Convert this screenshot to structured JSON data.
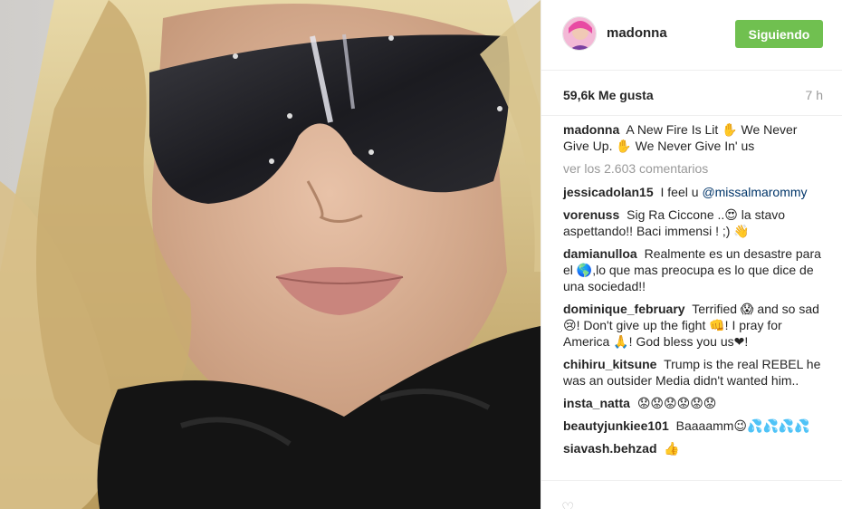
{
  "post": {
    "photo_alt": "",
    "header": {
      "username": "madonna",
      "follow_label": "Siguiendo"
    },
    "stats": {
      "likes": "59,6k Me gusta",
      "time": "7 h"
    },
    "caption": {
      "user": "madonna",
      "text": "A New Fire Is Lit ✋ We Never Give Up. ✋ We Never Give In' us"
    },
    "view_comments_label": "ver los 2.603 comentarios",
    "comments": [
      {
        "user": "jessicadolan15",
        "text": "I feel u",
        "mention": "@missalmarommy"
      },
      {
        "user": "vorenuss",
        "text": "Sig Ra Ciccone ..😍 la stavo aspettando!! Baci immensi ! ;) 👋",
        "mention": ""
      },
      {
        "user": "damianulloa",
        "text": "Realmente es un desastre para el 🌎,lo que mas preocupa es lo que dice de una sociedad!!",
        "mention": ""
      },
      {
        "user": "dominique_february",
        "text": "Terrified 😱 and so sad 😢! Don't give up the fight 👊! I pray for America 🙏! God bless you us❤!",
        "mention": ""
      },
      {
        "user": "chihiru_kitsune",
        "text": "Trump is the real REBEL he was an outsider Media didn't wanted him..",
        "mention": ""
      },
      {
        "user": "insta_natta",
        "text": "😟😟😟😟😟😟",
        "mention": ""
      },
      {
        "user": "beautyjunkiee101",
        "text": "Baaaamm😉💦💦💦💦",
        "mention": ""
      },
      {
        "user": "siavash.behzad",
        "text": "👍",
        "mention": ""
      }
    ]
  }
}
